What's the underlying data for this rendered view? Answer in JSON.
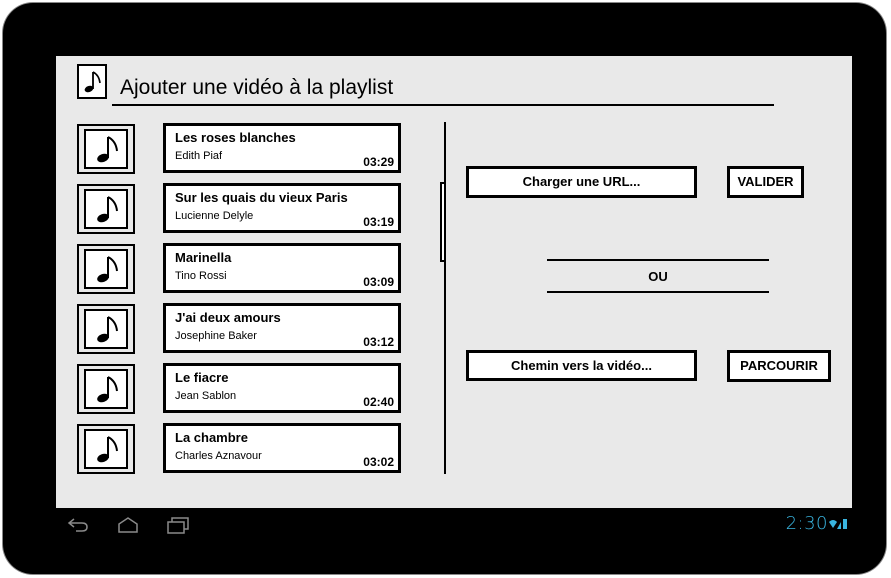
{
  "header": {
    "title": "Ajouter une vidéo à la playlist",
    "icon": "music-note-icon"
  },
  "playlist": [
    {
      "title": "Les roses blanches",
      "artist": "Edith Piaf",
      "duration": "03:29"
    },
    {
      "title": "Sur les quais du vieux Paris",
      "artist": "Lucienne Delyle",
      "duration": "03:19"
    },
    {
      "title": "Marinella",
      "artist": "Tino Rossi",
      "duration": "03:09"
    },
    {
      "title": "J'ai deux amours",
      "artist": "Josephine Baker",
      "duration": "03:12"
    },
    {
      "title": "Le fiacre",
      "artist": "Jean Sablon",
      "duration": "02:40"
    },
    {
      "title": "La chambre",
      "artist": "Charles Aznavour",
      "duration": "03:02"
    }
  ],
  "actions": {
    "load_url_label": "Charger une URL...",
    "validate_label": "VALIDER",
    "or_label": "OU",
    "video_path_label": "Chemin vers la vidéo...",
    "browse_label": "PARCOURIR"
  },
  "system_bar": {
    "time": "2:30",
    "accent_color": "#39b5e0",
    "icons": [
      "back-icon",
      "home-icon",
      "recent-apps-icon",
      "wifi-icon",
      "signal-icon",
      "battery-icon"
    ]
  }
}
